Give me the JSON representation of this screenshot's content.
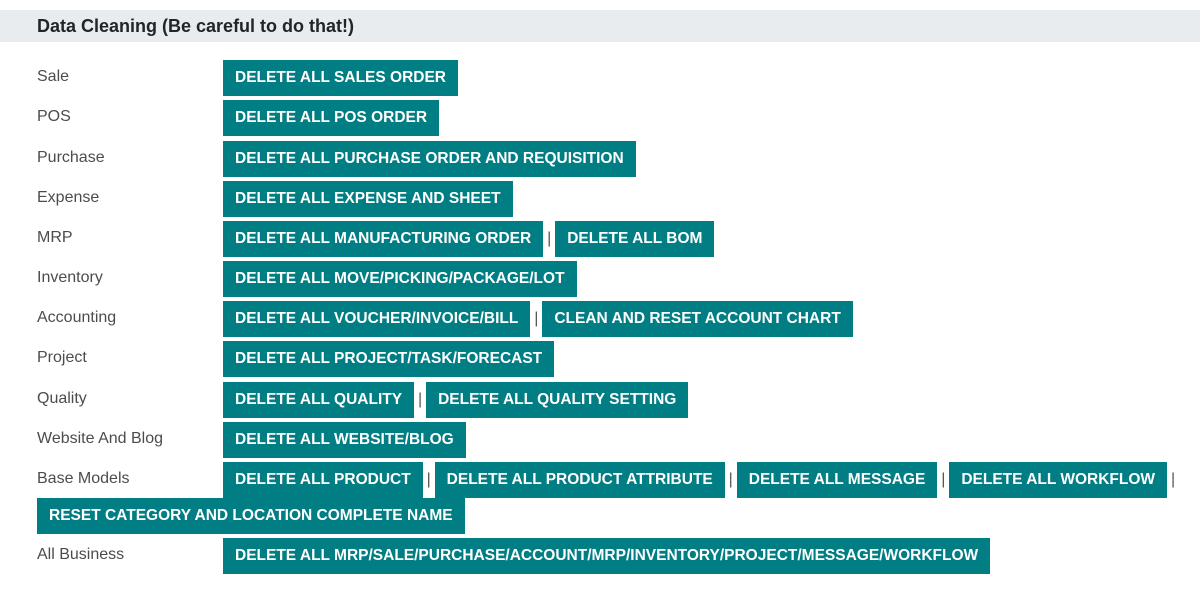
{
  "header": {
    "title": "Data Cleaning (Be careful to do that!)"
  },
  "rows": [
    {
      "label": "Sale",
      "buttons": [
        "DELETE ALL SALES ORDER"
      ]
    },
    {
      "label": "POS",
      "buttons": [
        "DELETE ALL POS ORDER"
      ]
    },
    {
      "label": "Purchase",
      "buttons": [
        "DELETE ALL PURCHASE ORDER AND REQUISITION"
      ]
    },
    {
      "label": "Expense",
      "buttons": [
        "DELETE ALL EXPENSE AND SHEET"
      ]
    },
    {
      "label": "MRP",
      "buttons": [
        "DELETE ALL MANUFACTURING ORDER",
        "DELETE ALL BOM"
      ]
    },
    {
      "label": "Inventory",
      "buttons": [
        "DELETE ALL MOVE/PICKING/PACKAGE/LOT"
      ]
    },
    {
      "label": "Accounting",
      "buttons": [
        "DELETE ALL VOUCHER/INVOICE/BILL",
        "CLEAN AND RESET ACCOUNT CHART"
      ]
    },
    {
      "label": "Project",
      "buttons": [
        "DELETE ALL PROJECT/TASK/FORECAST"
      ]
    },
    {
      "label": "Quality",
      "buttons": [
        "DELETE ALL QUALITY",
        "DELETE ALL QUALITY SETTING"
      ]
    },
    {
      "label": "Website And Blog",
      "buttons": [
        "DELETE ALL WEBSITE/BLOG"
      ]
    },
    {
      "label": "Base Models",
      "buttons": [
        "DELETE ALL PRODUCT",
        "DELETE ALL PRODUCT ATTRIBUTE",
        "DELETE ALL MESSAGE",
        "DELETE ALL WORKFLOW",
        "RESET CATEGORY AND LOCATION COMPLETE NAME"
      ]
    },
    {
      "label": "All Business",
      "buttons": [
        "DELETE ALL MRP/SALE/PURCHASE/ACCOUNT/MRP/INVENTORY/PROJECT/MESSAGE/WORKFLOW"
      ]
    }
  ],
  "separator": "|",
  "colors": {
    "button_bg": "#017e84",
    "button_text": "#ffffff",
    "header_bg": "#e9ecef"
  }
}
